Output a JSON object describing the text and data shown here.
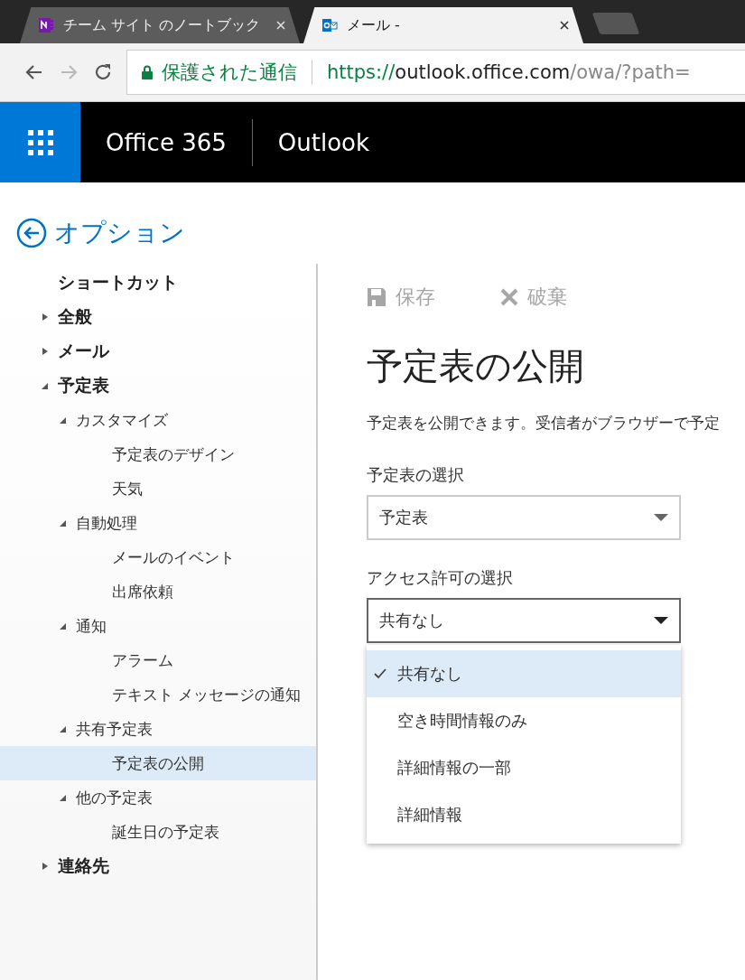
{
  "browser": {
    "tabs": [
      {
        "title": "チーム サイト のノートブック",
        "kind": "notebook",
        "selected": false
      },
      {
        "title": "メール -",
        "kind": "mail",
        "selected": true
      }
    ],
    "secure_label": "保護された通信",
    "url": {
      "scheme": "https://",
      "host": "outlook.office.com",
      "path": "/owa/?path="
    }
  },
  "header": {
    "suite": "Office 365",
    "app": "Outlook"
  },
  "back_title": "オプション",
  "sidebar": {
    "items": [
      {
        "label": "ショートカット",
        "selected": false
      },
      {
        "label": "全般",
        "expanded": false,
        "selected": false
      },
      {
        "label": "メール",
        "expanded": false,
        "selected": false
      },
      {
        "label": "予定表",
        "expanded": true,
        "selected": false,
        "children": [
          {
            "label": "カスタマイズ",
            "expanded": true,
            "selected": false,
            "children": [
              {
                "label": "予定表のデザイン",
                "selected": false
              },
              {
                "label": "天気",
                "selected": false
              }
            ]
          },
          {
            "label": "自動処理",
            "expanded": true,
            "selected": false,
            "children": [
              {
                "label": "メールのイベント",
                "selected": false
              },
              {
                "label": "出席依頼",
                "selected": false
              }
            ]
          },
          {
            "label": "通知",
            "expanded": true,
            "selected": false,
            "children": [
              {
                "label": "アラーム",
                "selected": false
              },
              {
                "label": "テキスト メッセージの通知",
                "selected": false
              }
            ]
          },
          {
            "label": "共有予定表",
            "expanded": true,
            "selected": false,
            "children": [
              {
                "label": "予定表の公開",
                "selected": true
              }
            ]
          },
          {
            "label": "他の予定表",
            "expanded": true,
            "selected": false,
            "children": [
              {
                "label": "誕生日の予定表",
                "selected": false
              }
            ]
          }
        ]
      },
      {
        "label": "連絡先",
        "expanded": false,
        "selected": false
      }
    ]
  },
  "toolbar": {
    "save": {
      "label": "保存",
      "disabled": true
    },
    "discard": {
      "label": "破棄",
      "disabled": true
    }
  },
  "page_title": "予定表の公開",
  "description": "予定表を公開できます。受信者がブラウザーで予定",
  "fields": [
    {
      "label": "予定表の選択",
      "value": "予定表",
      "open": false
    },
    {
      "label": "アクセス許可の選択",
      "value": "共有なし",
      "open": true
    }
  ],
  "dropdown_options": [
    {
      "label": "共有なし",
      "selected": true
    },
    {
      "label": "空き時間情報のみ",
      "selected": false
    },
    {
      "label": "詳細情報の一部",
      "selected": false
    },
    {
      "label": "詳細情報",
      "selected": false
    }
  ]
}
